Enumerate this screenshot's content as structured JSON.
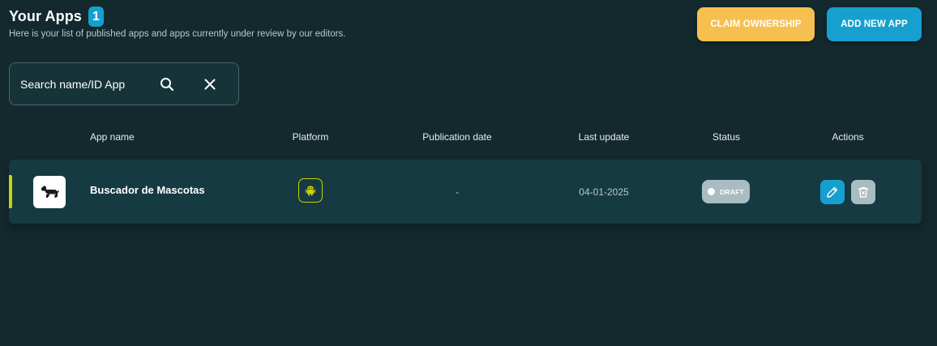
{
  "header": {
    "title": "Your Apps",
    "count": "1",
    "subtitle": "Here is your list of published apps and apps currently under review by our editors."
  },
  "buttons": {
    "claim_ownership": "CLAIM OWNERSHIP",
    "add_new_app": "ADD NEW APP"
  },
  "search": {
    "placeholder": "Search name/ID App",
    "value": ""
  },
  "table": {
    "columns": [
      "App name",
      "Platform",
      "Publication date",
      "Last update",
      "Status",
      "Actions"
    ],
    "rows": [
      {
        "app_name": "Buscador de Mascotas",
        "app_icon": "dog-icon",
        "platform": "android-icon",
        "publication_date": "-",
        "last_update": "04-01-2025",
        "status": "DRAFT"
      }
    ]
  },
  "colors": {
    "background": "#13292d",
    "row_background": "#163a42",
    "accent_blue": "#16a0cf",
    "accent_yellow": "#f5c04f",
    "accent_lime": "#c8d400",
    "status_gray": "#a9bcc1"
  }
}
